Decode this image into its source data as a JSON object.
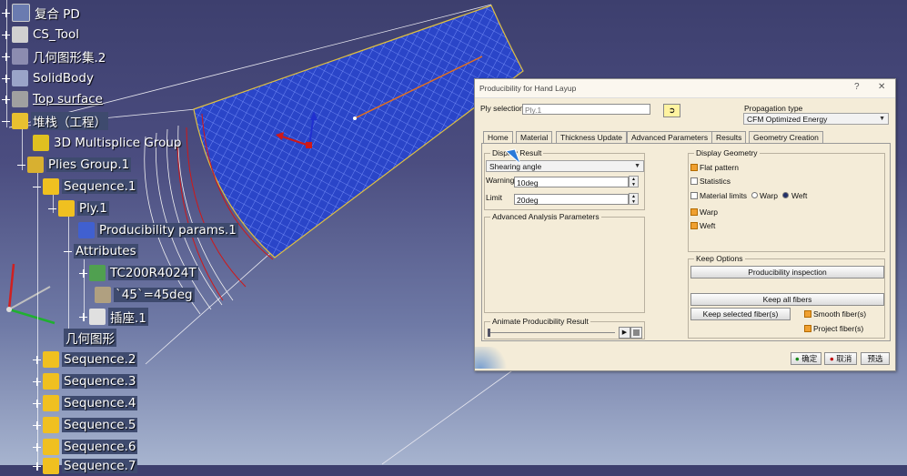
{
  "tree": {
    "items": [
      {
        "label": "复合 PD",
        "icon": "composites-icon"
      },
      {
        "label": "CS_Tool",
        "icon": "axis-system-icon"
      },
      {
        "label": "几何图形集.2",
        "icon": "geometrical-set-icon"
      },
      {
        "label": "SolidBody",
        "icon": "solid-body-icon"
      },
      {
        "label": "Top surface",
        "icon": "surface-icon"
      },
      {
        "label": "堆栈（工程）",
        "icon": "stacking-icon"
      },
      {
        "label": "3D Multisplice Group",
        "icon": "multisplice-icon"
      },
      {
        "label": "Plies Group.1",
        "icon": "plies-group-icon"
      },
      {
        "label": "Sequence.1",
        "icon": "sequence-icon"
      },
      {
        "label": "Ply.1",
        "icon": "ply-icon"
      },
      {
        "label": "Producibility params.1",
        "icon": "producibility-params-icon"
      },
      {
        "label": "Attributes",
        "icon": ""
      },
      {
        "label": "TC200R4024T",
        "icon": "material-icon"
      },
      {
        "label": "`45`=45deg",
        "icon": "parameter-icon"
      },
      {
        "label": "插座.1",
        "icon": "rosette-icon"
      },
      {
        "label": "几何图形",
        "icon": ""
      },
      {
        "label": "Sequence.2",
        "icon": "sequence-icon"
      },
      {
        "label": "Sequence.3",
        "icon": "sequence-icon"
      },
      {
        "label": "Sequence.4",
        "icon": "sequence-icon"
      },
      {
        "label": "Sequence.5",
        "icon": "sequence-icon"
      },
      {
        "label": "Sequence.6",
        "icon": "sequence-icon"
      },
      {
        "label": "Sequence.7",
        "icon": "sequence-icon"
      }
    ]
  },
  "dialog": {
    "title": "Producibility for Hand Layup",
    "help_glyph": "?",
    "close_glyph": "✕",
    "ply_selection_label": "Ply selection",
    "ply_selection_value": "Ply.1",
    "propagation_label": "Propagation type",
    "propagation_value": "CFM Optimized Energy",
    "tabs": [
      "Home",
      "Material",
      "Thickness Update",
      "Advanced Parameters",
      "Results",
      "Geometry Creation"
    ],
    "active_tab": "Home",
    "display_result_group": "Display Result",
    "display_result_value": "Shearing angle",
    "warning_label": "Warning",
    "warning_value": "10deg",
    "limit_label": "Limit",
    "limit_value": "20deg",
    "advanced_analysis_group": "Advanced Analysis Parameters",
    "animate_group": "Animate Producibility Result",
    "display_geometry_group": "Display Geometry",
    "flat_pattern": "Flat pattern",
    "statistics": "Statistics",
    "material_limits": "Material limits",
    "warp_radio": "Warp",
    "weft_radio": "Weft",
    "warp": "Warp",
    "weft": "Weft",
    "keep_options_group": "Keep Options",
    "producibility_inspection": "Producibility inspection",
    "keep_all_fibers": "Keep all fibers",
    "keep_selected_fibers": "Keep selected fiber(s)",
    "smooth_fibers": "Smooth fiber(s)",
    "project_fibers": "Project fiber(s)",
    "ok_label": "确定",
    "cancel_label": "取消",
    "preview_label": "预选",
    "checks": {
      "flat_pattern": true,
      "statistics": false,
      "material_limits": false,
      "warp": true,
      "weft": true,
      "smooth": true,
      "project": true
    },
    "weft_selected": true
  },
  "colors": {
    "mesh_blue": "#2a45c8",
    "red_contour": "#d01818",
    "dialog_bg": "#f4ecd8",
    "selection": "#3e4a6e"
  }
}
